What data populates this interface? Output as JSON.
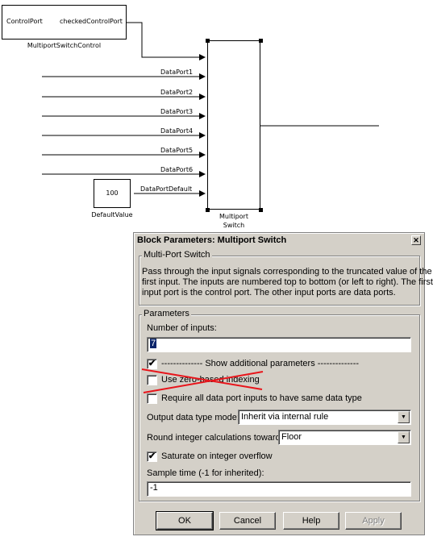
{
  "diagram": {
    "control_block": {
      "input_label": "ControlPort",
      "output_label": "checkedControlPort",
      "name": "MultiportSwitchControl"
    },
    "switch_block": {
      "name_line1": "Multiport",
      "name_line2": "Switch",
      "input_labels": [
        "DataPort1",
        "DataPort2",
        "DataPort3",
        "DataPort4",
        "DataPort5",
        "DataPort6",
        "DataPortDefault"
      ]
    },
    "constant_block": {
      "value": "100",
      "name": "DefaultValue"
    }
  },
  "dialog": {
    "title": "Block Parameters: Multiport Switch",
    "close_icon": "close-icon",
    "description_group": {
      "legend": "Multi-Port Switch",
      "text_line1": "Pass through the input signals corresponding to the truncated value of the",
      "text_line2": "first input. The inputs are numbered top to bottom (or left to right). The first",
      "text_line3": "input port is the control port. The other input ports are data ports."
    },
    "parameters_group": {
      "legend": "Parameters",
      "num_inputs_label": "Number of inputs:",
      "num_inputs_value": "7",
      "show_additional_label": "-------------- Show additional parameters --------------",
      "show_additional_checked": true,
      "zero_based_label": "Use zero-based indexing",
      "zero_based_checked": false,
      "zero_based_struck_out": true,
      "strike_color": "#e8151b",
      "same_type_label": "Require all data port inputs to have same data type",
      "same_type_checked": false,
      "output_mode_label": "Output data type mode:",
      "output_mode_value": "Inherit via internal rule",
      "round_label": "Round integer calculations toward:",
      "round_value": "Floor",
      "saturate_label": "Saturate on integer overflow",
      "saturate_checked": true,
      "sample_time_label": "Sample time (-1 for inherited):",
      "sample_time_value": "-1"
    },
    "buttons": {
      "ok": "OK",
      "cancel": "Cancel",
      "help": "Help",
      "apply": "Apply"
    }
  }
}
